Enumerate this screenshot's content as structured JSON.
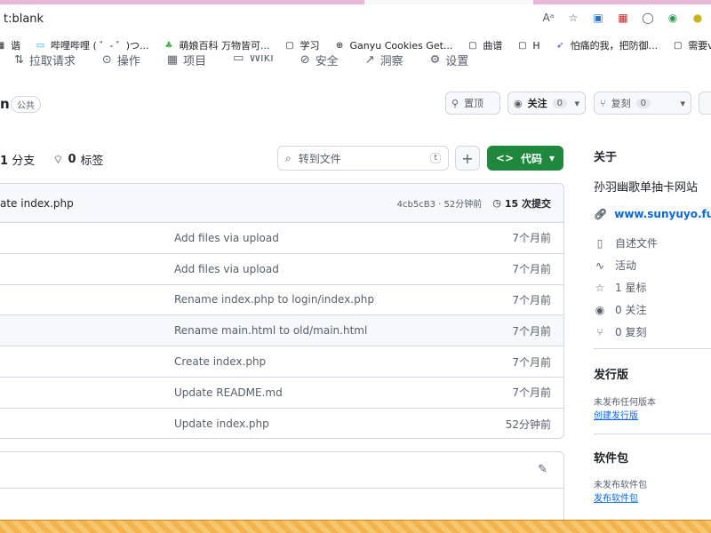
{
  "browser": {
    "url": "t:blank",
    "bookmarks": [
      {
        "icon": "grid-icon",
        "label": "谐"
      },
      {
        "icon": "bilibili-icon",
        "label": "哔哩哔哩 ( ゜- ゜)つ..."
      },
      {
        "icon": "moegirl-icon",
        "label": "萌娘百科 万物皆可..."
      },
      {
        "icon": "folder-icon",
        "label": "学习"
      },
      {
        "icon": "globe-icon",
        "label": "Ganyu Cookies Get..."
      },
      {
        "icon": "folder-icon",
        "label": "曲谱"
      },
      {
        "icon": "folder-icon",
        "label": "H"
      },
      {
        "icon": "feather-icon",
        "label": "怕痛的我，把防御..."
      },
      {
        "icon": "folder-icon",
        "label": "需要vpn的"
      }
    ]
  },
  "repo_nav": {
    "tabs": [
      "拉取请求",
      "操作",
      "项目",
      "Wiki",
      "安全",
      "洞察",
      "设置"
    ]
  },
  "repo": {
    "name": "n",
    "visibility": "公共",
    "pin_label": "置顶",
    "watch_label": "关注",
    "watch_count": "0",
    "fork_label": "复刻",
    "fork_count": "0"
  },
  "branch": {
    "branches": "1",
    "branches_label": "分支",
    "tags": "0",
    "tags_label": "标签",
    "goto_placeholder": "转到文件",
    "goto_key": "t",
    "code_label": "代码"
  },
  "latest_commit": {
    "message": "ate index.php",
    "hash": "4cb5cB3",
    "time": "52分钟前",
    "count": "15 次提交"
  },
  "files": [
    {
      "commit": "Add files via upload",
      "age": "7个月前"
    },
    {
      "commit": "Add files via upload",
      "age": "7个月前"
    },
    {
      "commit": "Rename index.php to login/index.php",
      "age": "7个月前"
    },
    {
      "commit": "Rename main.html to old/main.html",
      "age": "7个月前"
    },
    {
      "commit": "Create index.php",
      "age": "7个月前"
    },
    {
      "commit": "Update README.md",
      "age": "7个月前"
    },
    {
      "commit": "Update index.php",
      "age": "52分钟前"
    }
  ],
  "about": {
    "title": "关于",
    "description": "孙羽幽歌单抽卡网站",
    "website": "www.sunyuyo.fun",
    "readme": "自述文件",
    "activity": "活动",
    "stars": "1 星标",
    "watching": "0 关注",
    "forks": "0 复刻"
  },
  "releases": {
    "title": "发行版",
    "none": "未发布任何版本",
    "create": "创建发行版"
  },
  "packages": {
    "title": "软件包",
    "none": "未发布软件包",
    "publish": "发布软件包"
  }
}
